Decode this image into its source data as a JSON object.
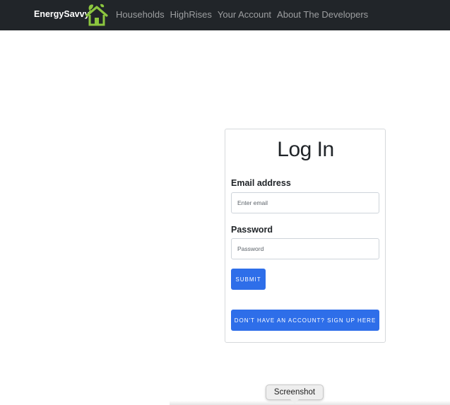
{
  "navbar": {
    "brand": "EnergySavvy",
    "logo_icon": "house-leaf-icon",
    "links": [
      {
        "label": "Households"
      },
      {
        "label": "HighRises"
      },
      {
        "label": "Your Account"
      },
      {
        "label": "About The Developers"
      }
    ]
  },
  "login": {
    "title": "Log In",
    "email_label": "Email address",
    "email_placeholder": "Enter email",
    "email_value": "",
    "password_label": "Password",
    "password_placeholder": "Password",
    "password_value": "",
    "submit_label": "Submit",
    "signup_label": "Don't have an account? Sign up here"
  },
  "tooltip": {
    "text": "Screenshot"
  },
  "colors": {
    "navbar_bg": "#212529",
    "button_primary": "#2e6ee9",
    "logo_green": "#8cc63f"
  }
}
